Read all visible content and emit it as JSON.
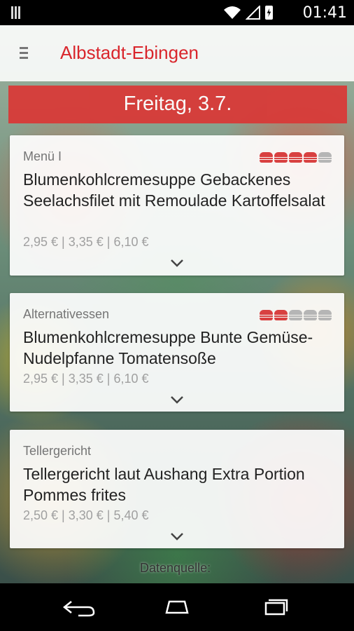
{
  "status_bar": {
    "time": "01:41",
    "icons": [
      "notification-icon",
      "wifi-icon",
      "signal-icon",
      "battery-charging-icon"
    ]
  },
  "app_bar": {
    "title": "Albstadt-Ebingen",
    "menu_icon": "hamburger-menu-icon"
  },
  "day": {
    "title": "Freitag, 3.7."
  },
  "meals": [
    {
      "category": "Menü I",
      "name": "Blumenkohlcremesuppe Gebackenes Seelachsfilet mit Remoulade Kartoffelsalat",
      "prices": "2,95 € | 3,35 € | 6,10 €",
      "rating": 4,
      "rating_max": 5
    },
    {
      "category": "Alternativessen",
      "name": "Blumenkohlcremesuppe Bunte Gemüse-Nudelpfanne Tomatensoße",
      "prices": "2,95 € | 3,35 € | 6,10 €",
      "rating": 2,
      "rating_max": 5
    },
    {
      "category": "Tellergericht",
      "name": "Tellergericht laut Aushang Extra Portion Pommes frites",
      "prices": "2,50 € | 3,30 € | 5,40 €"
    }
  ],
  "footer": {
    "datasource": "Datenquelle:"
  },
  "colors": {
    "accent": "#d9262c",
    "day_band": "#d83a38",
    "rating_active": "#d84040",
    "rating_inactive": "#b5b5b5"
  },
  "nav_bar": {
    "icons": [
      "back-icon",
      "home-icon",
      "recent-apps-icon"
    ]
  }
}
